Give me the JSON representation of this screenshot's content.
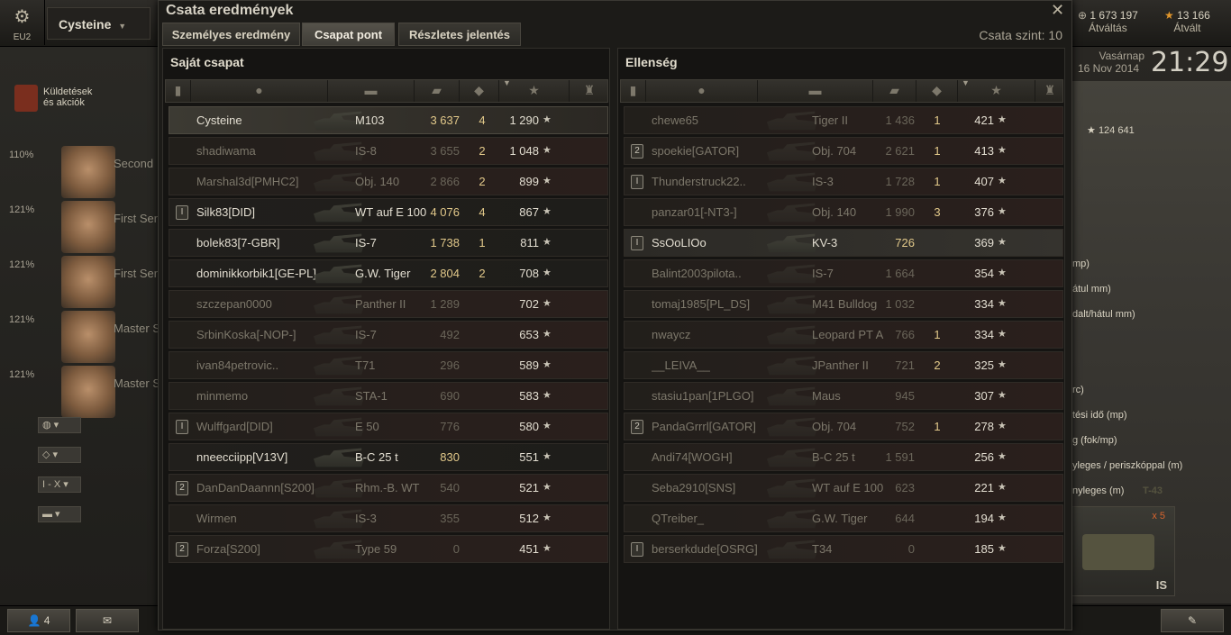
{
  "topbar": {
    "server": "EU2",
    "player_name": "Cysteine",
    "credits": "1 673 197",
    "credits_label": "Átváltás",
    "gold": "13 166",
    "gold_label": "Átvált",
    "day": "Vasárnap",
    "date": "16 Nov 2014",
    "time": "21:29"
  },
  "left_panel": {
    "missions_label_1": "Küldetések",
    "missions_label_2": "és akciók",
    "crew": [
      {
        "pct": "110%",
        "name": "Second"
      },
      {
        "pct": "121%",
        "name": "First Ser"
      },
      {
        "pct": "121%",
        "name": "First Ser"
      },
      {
        "pct": "121%",
        "name": "Master S"
      },
      {
        "pct": "121%",
        "name": "Master S"
      }
    ],
    "filter_tier": "I - X",
    "players_online": "4"
  },
  "garage_right": {
    "gold_value": "124 641",
    "lines": [
      "mp)",
      "átul mm)",
      "dalt/hátul mm)",
      "rc)",
      "tési idő (mp)",
      "g (fok/mp)",
      "yleges / periszkóppal (m)",
      "nyleges (m)"
    ],
    "tank_card_stars": "x 5",
    "tank_card_name": "IS",
    "tank_card_tier": "T-43"
  },
  "dialog": {
    "title": "Csata eredmények",
    "close_icon": "close-icon",
    "tabs": [
      "Személyes eredmény",
      "Csapat pont",
      "Részletes jelentés"
    ],
    "active_tab": 1,
    "battle_level": "Csata szint: 10",
    "own_team_title": "Saját csapat",
    "enemy_team_title": "Ellenség",
    "columns": [
      "squad-icon",
      "player-icon",
      "tank-icon",
      "damage-icon",
      "kills-icon",
      "xp-star-icon",
      "medal-icon"
    ]
  },
  "own_team": [
    {
      "badge": "",
      "name": "Cysteine",
      "tank": "M103",
      "damage": "3 637",
      "kills": "4",
      "xp": "1 290",
      "state": "own"
    },
    {
      "badge": "",
      "name": "shadiwama",
      "tank": "IS-8",
      "damage": "3 655",
      "kills": "2",
      "xp": "1 048",
      "state": "dead"
    },
    {
      "badge": "",
      "name": "Marshal3d[PMHC2]",
      "tank": "Obj. 140",
      "damage": "2 866",
      "kills": "2",
      "xp": "899",
      "state": "dead"
    },
    {
      "badge": "I",
      "name": "Silk83[DID]",
      "tank": "WT auf E 100",
      "damage": "4 076",
      "kills": "4",
      "xp": "867",
      "state": "alive"
    },
    {
      "badge": "",
      "name": "bolek83[7-GBR]",
      "tank": "IS-7",
      "damage": "1 738",
      "kills": "1",
      "xp": "811",
      "state": "alive"
    },
    {
      "badge": "",
      "name": "dominikkorbik1[GE-PL]",
      "tank": "G.W. Tiger",
      "damage": "2 804",
      "kills": "2",
      "xp": "708",
      "state": "alive"
    },
    {
      "badge": "",
      "name": "szczepan0000",
      "tank": "Panther II",
      "damage": "1 289",
      "kills": "",
      "xp": "702",
      "state": "dead"
    },
    {
      "badge": "",
      "name": "SrbinKoska[-NOP-]",
      "tank": "IS-7",
      "damage": "492",
      "kills": "",
      "xp": "653",
      "state": "dead"
    },
    {
      "badge": "",
      "name": "ivan84petrovic..",
      "tank": "T71",
      "damage": "296",
      "kills": "",
      "xp": "589",
      "state": "dead"
    },
    {
      "badge": "",
      "name": "minmemo",
      "tank": "STA-1",
      "damage": "690",
      "kills": "",
      "xp": "583",
      "state": "dead"
    },
    {
      "badge": "I",
      "name": "Wulffgard[DID]",
      "tank": "E 50",
      "damage": "776",
      "kills": "",
      "xp": "580",
      "state": "dead"
    },
    {
      "badge": "",
      "name": "nneecciipp[V13V]",
      "tank": "B-C 25 t",
      "damage": "830",
      "kills": "",
      "xp": "551",
      "state": "alive"
    },
    {
      "badge": "2",
      "name": "DanDanDaannn[S200]",
      "tank": "Rhm.-B. WT",
      "damage": "540",
      "kills": "",
      "xp": "521",
      "state": "dead"
    },
    {
      "badge": "",
      "name": "Wirmen",
      "tank": "IS-3",
      "damage": "355",
      "kills": "",
      "xp": "512",
      "state": "dead"
    },
    {
      "badge": "2",
      "name": "Forza[S200]",
      "tank": "Type 59",
      "damage": "0",
      "kills": "",
      "xp": "451",
      "state": "dead"
    }
  ],
  "enemy_team": [
    {
      "badge": "",
      "name": "chewe65",
      "tank": "Tiger II",
      "damage": "1 436",
      "kills": "1",
      "xp": "421",
      "state": "dead"
    },
    {
      "badge": "2",
      "name": "spoekie[GATOR]",
      "tank": "Obj. 704",
      "damage": "2 621",
      "kills": "1",
      "xp": "413",
      "state": "dead"
    },
    {
      "badge": "I",
      "name": "Thunderstruck22..",
      "tank": "IS-3",
      "damage": "1 728",
      "kills": "1",
      "xp": "407",
      "state": "dead"
    },
    {
      "badge": "",
      "name": "panzar01[-NT3-]",
      "tank": "Obj. 140",
      "damage": "1 990",
      "kills": "3",
      "xp": "376",
      "state": "dead"
    },
    {
      "badge": "I",
      "name": "SsOoLIOo",
      "tank": "KV-3",
      "damage": "726",
      "kills": "",
      "xp": "369",
      "state": "highlight"
    },
    {
      "badge": "",
      "name": "Balint2003pilota..",
      "tank": "IS-7",
      "damage": "1 664",
      "kills": "",
      "xp": "354",
      "state": "dead"
    },
    {
      "badge": "",
      "name": "tomaj1985[PL_DS]",
      "tank": "M41 Bulldog",
      "damage": "1 032",
      "kills": "",
      "xp": "334",
      "state": "dead"
    },
    {
      "badge": "",
      "name": "nwaycz",
      "tank": "Leopard PT A",
      "damage": "766",
      "kills": "1",
      "xp": "334",
      "state": "dead"
    },
    {
      "badge": "",
      "name": "__LEIVA__",
      "tank": "JPanther II",
      "damage": "721",
      "kills": "2",
      "xp": "325",
      "state": "dead"
    },
    {
      "badge": "",
      "name": "stasiu1pan[1PLGO]",
      "tank": "Maus",
      "damage": "945",
      "kills": "",
      "xp": "307",
      "state": "dead"
    },
    {
      "badge": "2",
      "name": "PandaGrrrl[GATOR]",
      "tank": "Obj. 704",
      "damage": "752",
      "kills": "1",
      "xp": "278",
      "state": "dead"
    },
    {
      "badge": "",
      "name": "Andi74[WOGH]",
      "tank": "B-C 25 t",
      "damage": "1 591",
      "kills": "",
      "xp": "256",
      "state": "dead"
    },
    {
      "badge": "",
      "name": "Seba2910[SNS]",
      "tank": "WT auf E 100",
      "damage": "623",
      "kills": "",
      "xp": "221",
      "state": "dead"
    },
    {
      "badge": "",
      "name": "QTreiber_",
      "tank": "G.W. Tiger",
      "damage": "644",
      "kills": "",
      "xp": "194",
      "state": "dead"
    },
    {
      "badge": "I",
      "name": "berserkdude[OSRG]",
      "tank": "T34",
      "damage": "0",
      "kills": "",
      "xp": "185",
      "state": "dead"
    }
  ],
  "star_glyph": "★"
}
